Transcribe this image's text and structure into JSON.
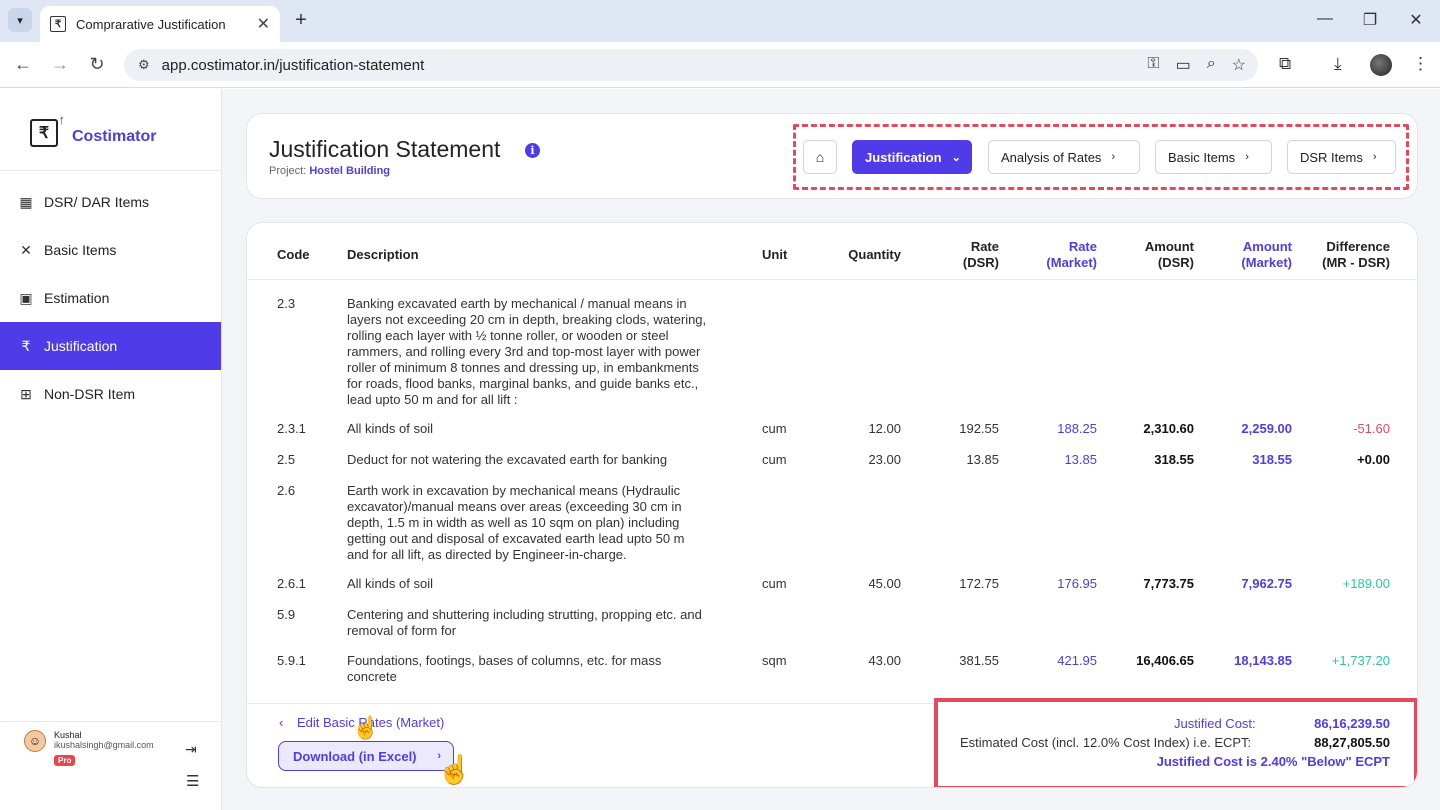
{
  "browser": {
    "tab_title": "Comprarative Justification",
    "url": "app.costimator.in/justification-statement"
  },
  "sidebar": {
    "brand": "Costimator",
    "items": [
      {
        "label": "DSR/ DAR Items",
        "icon": "table-grid-icon"
      },
      {
        "label": "Basic Items",
        "icon": "tools-icon"
      },
      {
        "label": "Estimation",
        "icon": "calculator-icon"
      },
      {
        "label": "Justification",
        "icon": "rupee-icon",
        "active": true
      },
      {
        "label": "Non-DSR Item",
        "icon": "add-box-icon"
      }
    ],
    "user": {
      "name": "Kushal",
      "email": "ikushalsingh@gmail.com",
      "badge": "Pro"
    }
  },
  "header": {
    "title": "Justification Statement",
    "project_label": "Project:",
    "project_name": "Hostel Building",
    "breadcrumbs": [
      {
        "label": "Justification",
        "active": true
      },
      {
        "label": "Analysis of Rates"
      },
      {
        "label": "Basic Items"
      },
      {
        "label": "DSR Items"
      }
    ]
  },
  "table": {
    "columns": {
      "code": "Code",
      "description": "Description",
      "unit": "Unit",
      "quantity": "Quantity",
      "rate_dsr": [
        "Rate",
        "(DSR)"
      ],
      "rate_market": [
        "Rate",
        "(Market)"
      ],
      "amount_dsr": [
        "Amount",
        "(DSR)"
      ],
      "amount_market": [
        "Amount",
        "(Market)"
      ],
      "difference": [
        "Difference",
        "(MR - DSR)"
      ]
    },
    "rows": [
      {
        "code": "2.3",
        "description": [
          "Banking excavated earth by mechanical / manual means in",
          "layers not exceeding 20 cm in depth, breaking clods, watering,",
          "rolling each layer with ½ tonne roller, or wooden or steel",
          "rammers, and rolling every 3rd and top-most layer with power",
          "roller of minimum 8 tonnes and dressing up, in embankments",
          "for roads, flood banks, marginal banks, and guide banks etc.,",
          "lead upto 50 m and for all lift :"
        ]
      },
      {
        "code": "2.3.1",
        "description": [
          "All kinds of soil"
        ],
        "unit": "cum",
        "quantity": "12.00",
        "rate_dsr": "192.55",
        "rate_market": "188.25",
        "amount_dsr": "2,310.60",
        "amount_market": "2,259.00",
        "difference": "-51.60",
        "sign": "neg"
      },
      {
        "code": "2.5",
        "description": [
          "Deduct for not watering the excavated earth for banking"
        ],
        "unit": "cum",
        "quantity": "23.00",
        "rate_dsr": "13.85",
        "rate_market": "13.85",
        "amount_dsr": "318.55",
        "amount_market": "318.55",
        "difference": "+0.00",
        "sign": "zero"
      },
      {
        "code": "2.6",
        "description": [
          "Earth work in excavation by mechanical means (Hydraulic",
          "excavator)/manual means over areas (exceeding 30 cm in",
          "depth, 1.5 m in width as well as 10 sqm on plan) including",
          "getting out and disposal of excavated earth lead upto 50 m",
          "and for all lift, as directed by Engineer-in-charge."
        ]
      },
      {
        "code": "2.6.1",
        "description": [
          "All kinds of soil"
        ],
        "unit": "cum",
        "quantity": "45.00",
        "rate_dsr": "172.75",
        "rate_market": "176.95",
        "amount_dsr": "7,773.75",
        "amount_market": "7,962.75",
        "difference": "+189.00",
        "sign": "pos"
      },
      {
        "code": "5.9",
        "description": [
          "Centering and shuttering including strutting, propping etc. and",
          "removal of form for"
        ]
      },
      {
        "code": "5.9.1",
        "description": [
          "Foundations, footings, bases of columns, etc. for mass",
          "concrete"
        ],
        "unit": "sqm",
        "quantity": "43.00",
        "rate_dsr": "381.55",
        "rate_market": "421.95",
        "amount_dsr": "16,406.65",
        "amount_market": "18,143.85",
        "difference": "+1,737.20",
        "sign": "pos"
      }
    ]
  },
  "footer": {
    "edit_link": "Edit Basic Rates (Market)",
    "download_button": "Download (in Excel)",
    "justified_cost_label": "Justified Cost:",
    "justified_cost_value": "86,16,239.50",
    "estimated_cost_label": "Estimated Cost (incl. 12.0% Cost Index) i.e. ECPT:",
    "estimated_cost_value": "88,27,805.50",
    "summary_note": "Justified Cost is  2.40% \"Below\" ECPT"
  },
  "colors": {
    "accent": "#4f3ce8",
    "highlight": "#e24b5b",
    "positive": "#2ec4a6",
    "negative": "#e24b5b"
  }
}
